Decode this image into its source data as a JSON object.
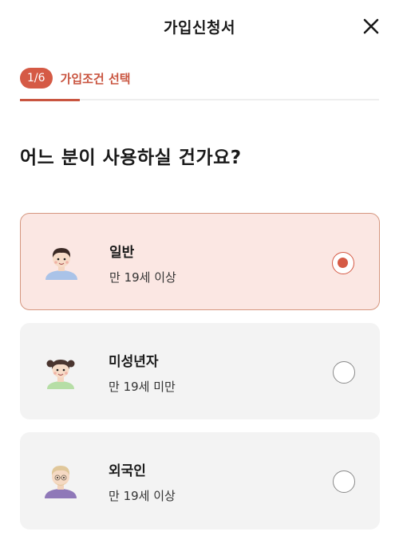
{
  "header": {
    "title": "가입신청서",
    "close_icon": "close-icon"
  },
  "progress": {
    "step": "1/6",
    "label": "가입조건 선택",
    "value": 0.1667
  },
  "question": "어느 분이 사용하실 건가요?",
  "options": [
    {
      "title": "일반",
      "desc": "만 19세 이상",
      "selected": true,
      "icon": "adult-avatar-icon"
    },
    {
      "title": "미성년자",
      "desc": "만 19세 미만",
      "selected": false,
      "icon": "child-avatar-icon"
    },
    {
      "title": "외국인",
      "desc": "만 19세 이상",
      "selected": false,
      "icon": "foreigner-avatar-icon"
    }
  ],
  "colors": {
    "accent": "#d55a45",
    "selected_bg": "#fbe7e3",
    "card_bg": "#f3f3f3"
  }
}
